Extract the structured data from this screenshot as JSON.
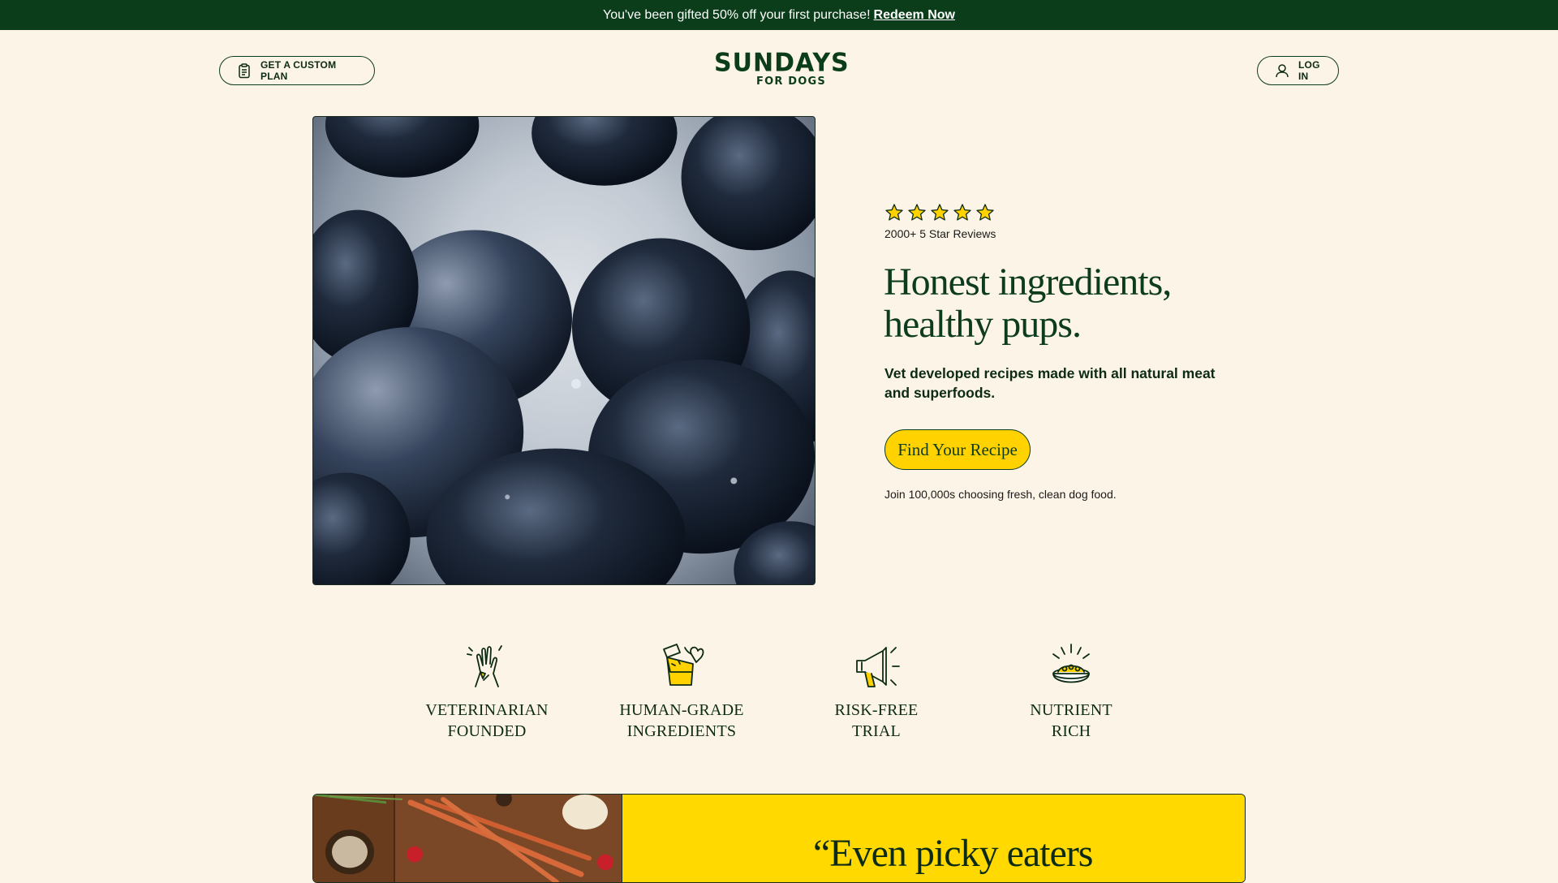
{
  "promo": {
    "text": "You've been gifted 50% off your first purchase!",
    "link": "Redeem Now",
    "bg_color": "#0b3d1a"
  },
  "header": {
    "custom_plan_label": "GET A CUSTOM PLAN",
    "custom_plan_icon": "clipboard-icon",
    "logo_line1": "SUNDAYS",
    "logo_line2": "FOR DOGS",
    "login_label": "LOG IN",
    "login_icon": "user-icon"
  },
  "hero": {
    "image": "blueberries-closeup",
    "rating_stars": 5,
    "reviews": "2000+ 5 Star Reviews",
    "headline": "Honest ingredients, healthy pups.",
    "subhead": "Vet developed recipes made with all natural meat and superfoods.",
    "cta": "Find Your Recipe",
    "join_text": "Join 100,000s choosing fresh, clean dog food.",
    "accent_color": "#ffd200"
  },
  "features": [
    {
      "icon": "high-five-icon",
      "line1": "VETERINARIAN",
      "line2": "FOUNDED"
    },
    {
      "icon": "food-ingredients-icon",
      "line1": "HUMAN-GRADE",
      "line2": "INGREDIENTS"
    },
    {
      "icon": "megaphone-icon",
      "line1": "RISK-FREE",
      "line2": "TRIAL"
    },
    {
      "icon": "food-bowl-icon",
      "line1": "NUTRIENT",
      "line2": "RICH"
    }
  ],
  "testimonial": {
    "image": "vegetables-on-cutting-board",
    "quote_start": "“Even picky eaters"
  }
}
